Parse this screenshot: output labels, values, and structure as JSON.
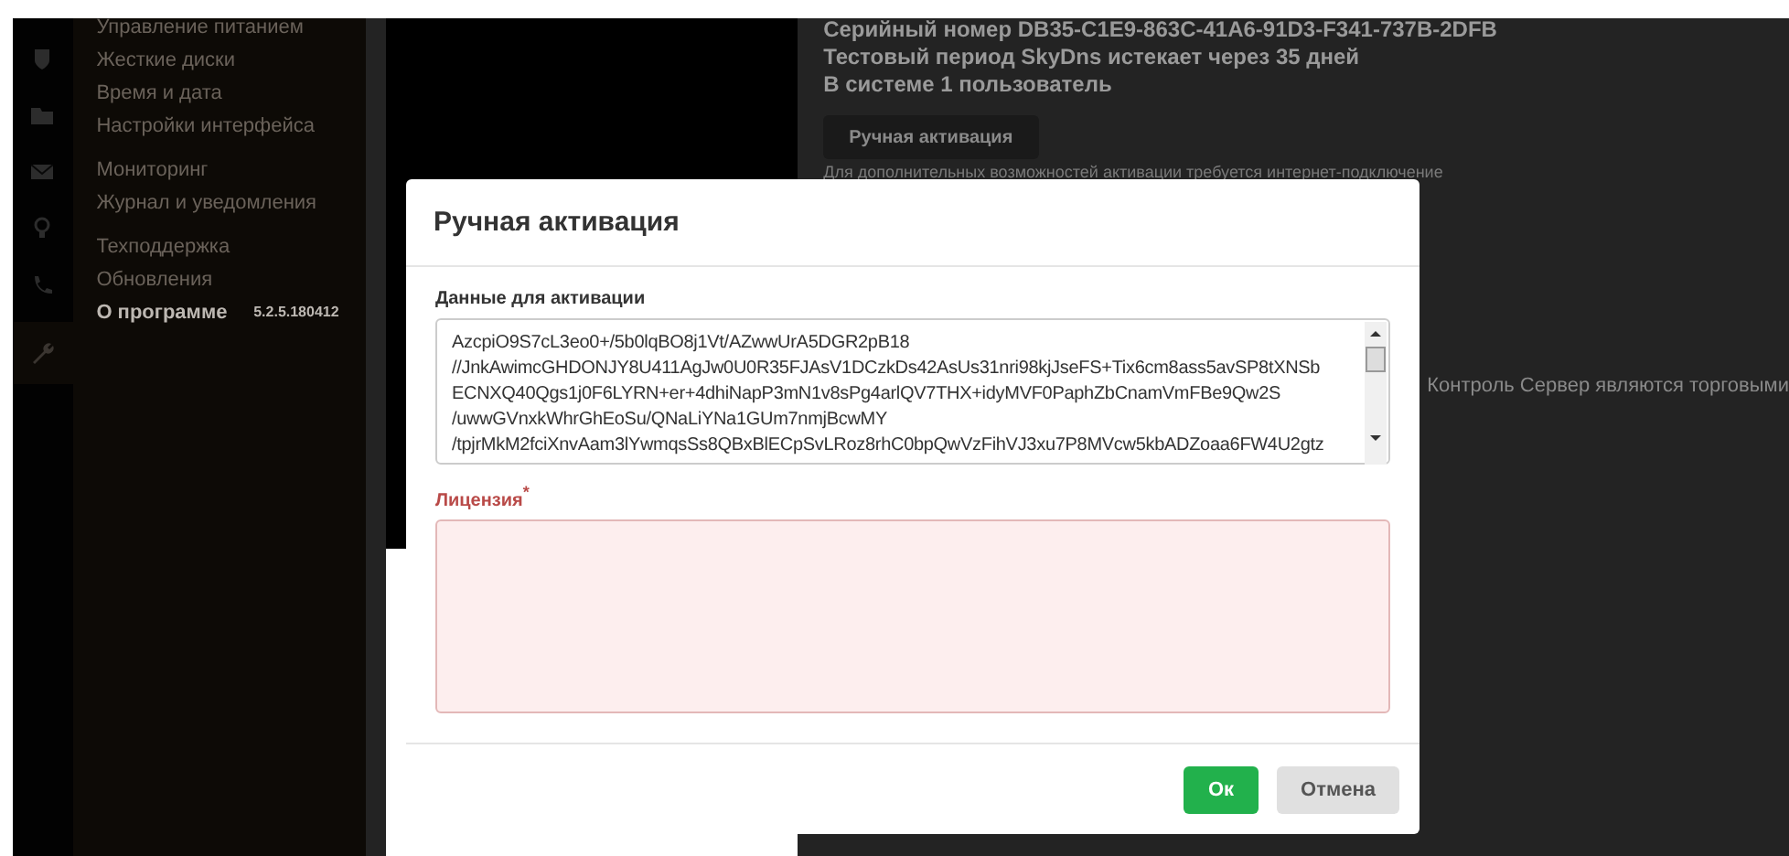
{
  "sidebar": {
    "icons": [
      {
        "kind": "shield",
        "selected": false
      },
      {
        "kind": "folder",
        "selected": false
      },
      {
        "kind": "envelope",
        "selected": false
      },
      {
        "kind": "bulb",
        "selected": false
      },
      {
        "kind": "phone",
        "selected": false
      },
      {
        "kind": "wrench",
        "selected": true
      }
    ],
    "groups": [
      {
        "items": [
          {
            "label": "Управление питанием",
            "selected": false
          },
          {
            "label": "Жесткие диски",
            "selected": false
          },
          {
            "label": "Время и дата",
            "selected": false
          },
          {
            "label": "Настройки интерфейса",
            "selected": false
          }
        ]
      },
      {
        "items": [
          {
            "label": "Мониторинг",
            "selected": false
          },
          {
            "label": "Журнал и уведомления",
            "selected": false
          }
        ]
      },
      {
        "items": [
          {
            "label": "Техподдержка",
            "selected": false
          },
          {
            "label": "Обновления",
            "selected": false
          },
          {
            "label": "О программе",
            "selected": true,
            "version": "5.2.5.180412"
          }
        ]
      }
    ]
  },
  "info": {
    "lines": [
      "Серийный номер DB35-C1E9-863C-41A6-91D3-F341-737B-2DFB",
      "Тестовый период SkyDns истекает через 35 дней",
      "В системе 1 пользователь"
    ],
    "button": "Ручная активация",
    "hint": "Для дополнительных возможностей активации требуется интернет-подключение",
    "trademark": "Контроль Сервер являются торговыми"
  },
  "modal": {
    "title": "Ручная активация",
    "data_label": "Данные для активации",
    "data_lines": [
      "AzcpiO9S7cL3eo0+/5b0lqBO8j1Vt/AZwwUrA5DGR2pB18",
      "//JnkAwimcGHDONJY8U411AgJw0U0R35FJAsV1DCzkDs42AsUs31nri98kjJseFS+Tix6cm8ass5avSP8tXNSb",
      "ECNXQ40Qgs1j0F6LYRN+er+4dhiNapP3mN1v8sPg4arlQV7THX+idyMVF0PaphZbCnamVmFBe9Qw2S",
      "/uwwGVnxkWhrGhEoSu/QNaLiYNa1GUm7nmjBcwMY",
      "/tpjrMkM2fciXnvAam3lYwmqsSs8QBxBlECpSvLRoz8rhC0bpQwVzFihVJ3xu7P8MVcw5kbADZoaa6FW4U2gtz"
    ],
    "license_label": "Лицензия",
    "required_mark": "*",
    "license_invalid": true,
    "ok": "Ок",
    "cancel": "Отмена"
  }
}
